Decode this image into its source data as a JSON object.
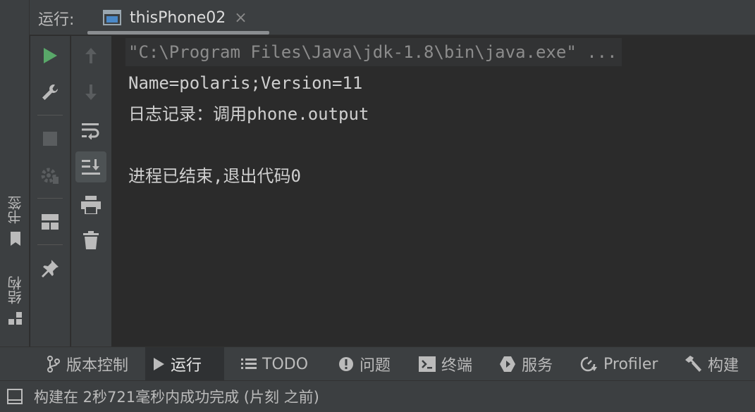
{
  "header": {
    "run_label": "运行:",
    "tab_title": "thisPhone02",
    "tab_close": "×"
  },
  "left_stripe": {
    "bookmarks_label": "书签",
    "structure_label": "结构"
  },
  "console": {
    "lines": [
      "\"C:\\Program Files\\Java\\jdk-1.8\\bin\\java.exe\" ...",
      "Name=polaris;Version=11",
      "日志记录：调用phone.output",
      "",
      "进程已结束,退出代码0"
    ]
  },
  "bottom_tabs": [
    {
      "label": "版本控制",
      "icon": "branch-icon"
    },
    {
      "label": "运行",
      "icon": "run-icon",
      "active": true
    },
    {
      "label": "TODO",
      "icon": "list-icon"
    },
    {
      "label": "问题",
      "icon": "problems-icon"
    },
    {
      "label": "终端",
      "icon": "terminal-icon"
    },
    {
      "label": "服务",
      "icon": "services-icon"
    },
    {
      "label": "Profiler",
      "icon": "profiler-icon"
    },
    {
      "label": "构建",
      "icon": "hammer-icon"
    }
  ],
  "status": {
    "text": "构建在 2秒721毫秒内成功完成 (片刻 之前)"
  },
  "colors": {
    "accent_green": "#59a869",
    "panel_bg": "#3c3f41",
    "editor_bg": "#2b2b2b"
  }
}
